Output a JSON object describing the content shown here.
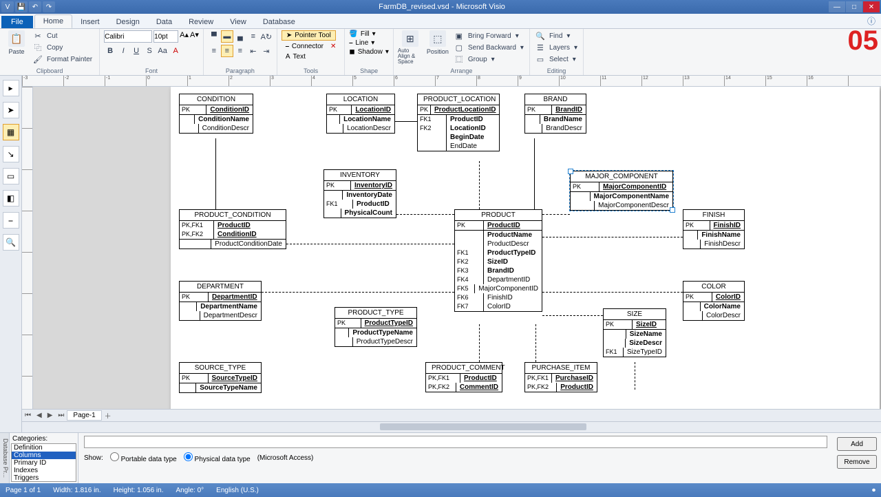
{
  "title": "FarmDB_revised.vsd - Microsoft Visio",
  "stamp": "05",
  "ribbon_tabs": {
    "file": "File",
    "home": "Home",
    "insert": "Insert",
    "design": "Design",
    "data": "Data",
    "review": "Review",
    "view": "View",
    "database": "Database"
  },
  "clipboard": {
    "paste": "Paste",
    "cut": "Cut",
    "copy": "Copy",
    "fp": "Format Painter",
    "label": "Clipboard"
  },
  "font": {
    "name": "Calibri",
    "size": "10pt",
    "label": "Font"
  },
  "paragraph": {
    "label": "Paragraph"
  },
  "tools": {
    "pointer": "Pointer Tool",
    "connector": "Connector",
    "text": "Text",
    "label": "Tools"
  },
  "shape": {
    "fill": "Fill",
    "line": "Line",
    "shadow": "Shadow",
    "label": "Shape"
  },
  "arrange": {
    "autoalign": "Auto Align & Space",
    "position": "Position",
    "forward": "Bring Forward",
    "backward": "Send Backward",
    "group": "Group",
    "label": "Arrange"
  },
  "editing": {
    "find": "Find",
    "layers": "Layers",
    "select": "Select",
    "label": "Editing"
  },
  "page_tab": "Page-1",
  "entities": {
    "condition": {
      "name": "CONDITION",
      "pk": "PK",
      "pkval": "ConditionID",
      "r1": "ConditionName",
      "r2": "ConditionDescr"
    },
    "location": {
      "name": "LOCATION",
      "pk": "PK",
      "pkval": "LocationID",
      "r1": "LocationName",
      "r2": "LocationDescr"
    },
    "product_location": {
      "name": "PRODUCT_LOCATION",
      "pk": "PK",
      "pkval": "ProductLocationID",
      "fk1": "FK1",
      "fk1v": "ProductID",
      "fk2": "FK2",
      "fk2v": "LocationID",
      "r3": "BeginDate",
      "r4": "EndDate"
    },
    "brand": {
      "name": "BRAND",
      "pk": "PK",
      "pkval": "BrandID",
      "r1": "BrandName",
      "r2": "BrandDescr"
    },
    "inventory": {
      "name": "INVENTORY",
      "pk": "PK",
      "pkval": "InventoryID",
      "fk1": "FK1",
      "r1": "InventoryDate",
      "r2": "ProductID",
      "r3": "PhysicalCount"
    },
    "product_condition": {
      "name": "PRODUCT_CONDITION",
      "k1": "PK,FK1",
      "k1v": "ProductID",
      "k2": "PK,FK2",
      "k2v": "ConditionID",
      "r1": "ProductConditionDate"
    },
    "major_component": {
      "name": "MAJOR_COMPONENT",
      "pk": "PK",
      "pkval": "MajorComponentID",
      "r1": "MajorComponentName",
      "r2": "MajorComponentDescr"
    },
    "product": {
      "name": "PRODUCT",
      "pk": "PK",
      "pkval": "ProductID",
      "r1": "ProductName",
      "r2": "ProductDescr",
      "fk1": "FK1",
      "fk1v": "ProductTypeID",
      "fk2": "FK2",
      "fk2v": "SizeID",
      "fk3": "FK3",
      "fk3v": "BrandID",
      "fk4": "FK4",
      "fk4v": "DepartmentID",
      "fk5": "FK5",
      "fk5v": "MajorComponentID",
      "fk6": "FK6",
      "fk6v": "FinishID",
      "fk7": "FK7",
      "fk7v": "ColorID"
    },
    "finish": {
      "name": "FINISH",
      "pk": "PK",
      "pkval": "FinishID",
      "r1": "FinishName",
      "r2": "FinishDescr"
    },
    "department": {
      "name": "DEPARTMENT",
      "pk": "PK",
      "pkval": "DepartmentID",
      "r1": "DepartmentName",
      "r2": "DepartmentDescr"
    },
    "product_type": {
      "name": "PRODUCT_TYPE",
      "pk": "PK",
      "pkval": "ProductTypeID",
      "r1": "ProductTypeName",
      "r2": "ProductTypeDescr"
    },
    "color": {
      "name": "COLOR",
      "pk": "PK",
      "pkval": "ColorID",
      "r1": "ColorName",
      "r2": "ColorDescr"
    },
    "size": {
      "name": "SIZE",
      "pk": "PK",
      "pkval": "SizeID",
      "r1": "SizeName",
      "r2": "SizeDescr",
      "fk1": "FK1",
      "fk1v": "SizeTypeID"
    },
    "source_type": {
      "name": "SOURCE_TYPE",
      "pk": "PK",
      "pkval": "SourceTypeID",
      "r1": "SourceTypeName"
    },
    "product_comment": {
      "name": "PRODUCT_COMMENT",
      "k1": "PK,FK1",
      "k1v": "ProductID",
      "k2": "PK,FK2",
      "k2v": "CommentID"
    },
    "purchase_item": {
      "name": "PURCHASE_ITEM",
      "k1": "PK,FK1",
      "k1v": "PurchaseID",
      "k2": "PK,FK2",
      "k2v": "ProductID"
    }
  },
  "db_panel": {
    "tab": "Database Pr...",
    "categories_label": "Categories:",
    "cats": {
      "c1": "Definition",
      "c2": "Columns",
      "c3": "Primary ID",
      "c4": "Indexes",
      "c5": "Triggers"
    },
    "show": "Show:",
    "opt1": "Portable data type",
    "opt2": "Physical data type",
    "opt3": "(Microsoft Access)",
    "add": "Add",
    "remove": "Remove"
  },
  "status": {
    "page": "Page 1 of 1",
    "width": "Width: 1.816 in.",
    "height": "Height: 1.056 in.",
    "angle": "Angle: 0°",
    "lang": "English (U.S.)"
  }
}
